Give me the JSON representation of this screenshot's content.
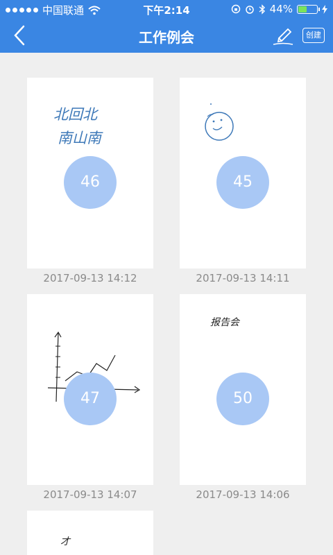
{
  "status": {
    "carrier": "中国联通",
    "time": "下午2:14",
    "battery_pct": "44%",
    "battery_level": 0.44
  },
  "nav": {
    "title": "工作例会",
    "create_label": "创建"
  },
  "cards": [
    {
      "number": "46",
      "date": "2017-09-13 14:12",
      "sketch_text": [
        "北回北",
        "南山南"
      ]
    },
    {
      "number": "45",
      "date": "2017-09-13 14:11",
      "sketch_text": []
    },
    {
      "number": "47",
      "date": "2017-09-13 14:07",
      "sketch_text": []
    },
    {
      "number": "50",
      "date": "2017-09-13 14:06",
      "sketch_text": [
        "报告会"
      ]
    },
    {
      "number": "",
      "date": "",
      "sketch_text": [
        "才"
      ]
    }
  ],
  "colors": {
    "accent": "#3a86e3",
    "badge": "#a9c8f5",
    "background": "#efefef",
    "ink_blue": "#3d78b8"
  }
}
